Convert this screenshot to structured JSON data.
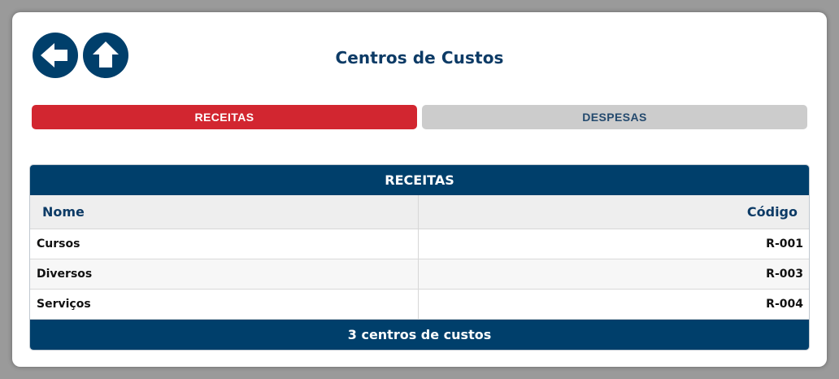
{
  "header": {
    "title": "Centros de Custos",
    "back_icon": "arrow-left-icon",
    "home_icon": "arrow-up-icon"
  },
  "tabs": [
    {
      "label": "RECEITAS",
      "active": true,
      "color": "#d22630"
    },
    {
      "label": "DESPESAS",
      "active": false,
      "color": "#cccccc"
    }
  ],
  "table": {
    "title": "RECEITAS",
    "columns": [
      "Nome",
      "Código"
    ],
    "rows": [
      {
        "nome": "Cursos",
        "codigo": "R-001"
      },
      {
        "nome": "Diversos",
        "codigo": "R-003"
      },
      {
        "nome": "Serviços",
        "codigo": "R-004"
      }
    ],
    "footer": "3 centros de custos"
  },
  "colors": {
    "primary": "#003f6b",
    "accent": "#d22630",
    "title": "#0d3b66"
  }
}
